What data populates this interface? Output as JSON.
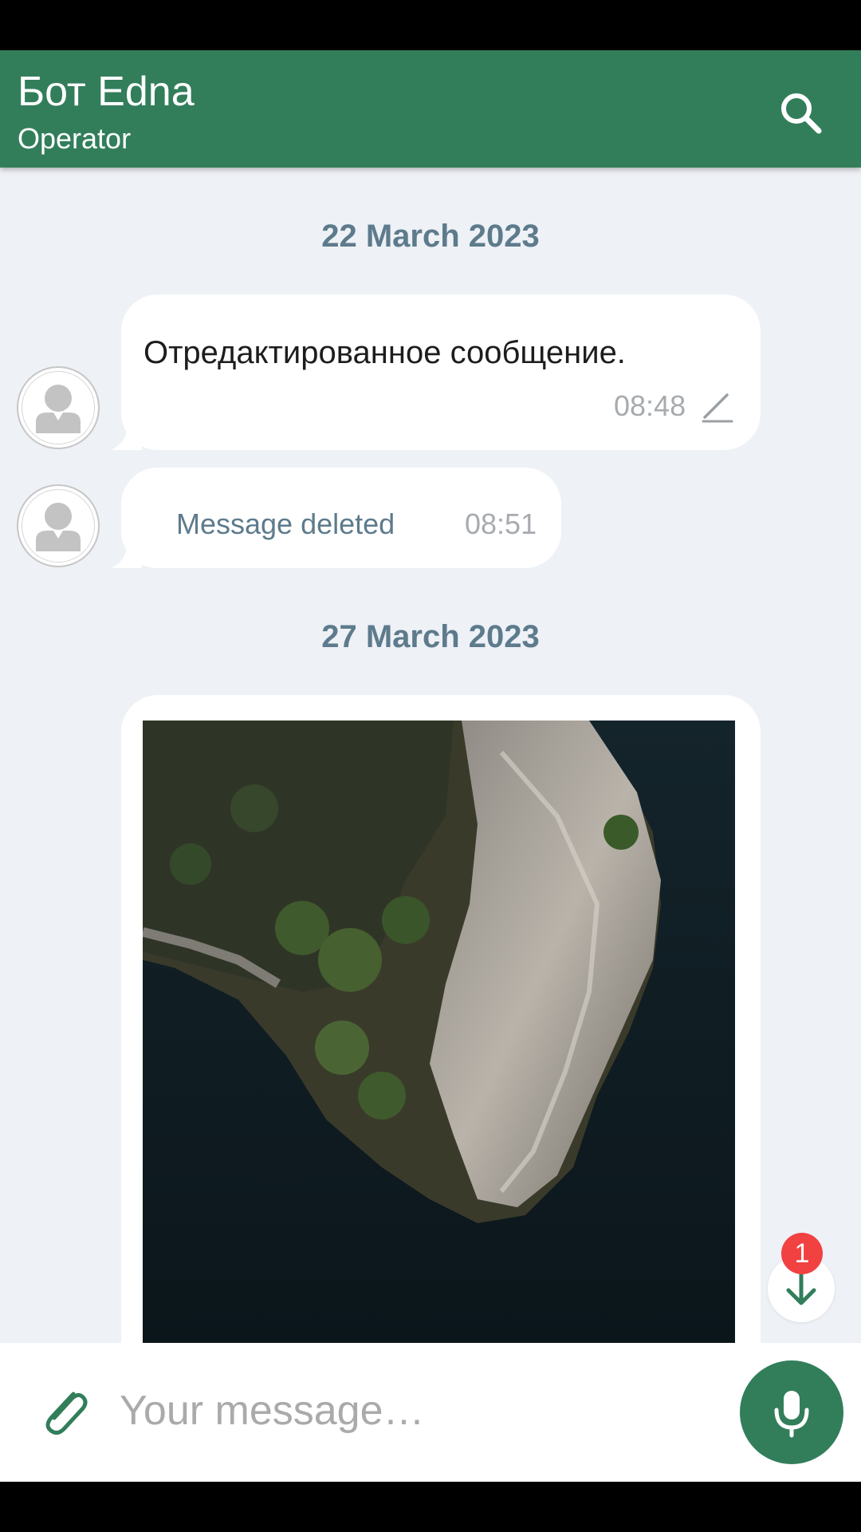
{
  "header": {
    "title": "Бот Edna",
    "subtitle": "Operator",
    "search_icon": "search-icon"
  },
  "colors": {
    "primary": "#327e5b",
    "background": "#eef1f6",
    "date_text": "#5d7b8c",
    "badge": "#f14141"
  },
  "messages": [
    {
      "date": "22 March 2023",
      "items": [
        {
          "type": "text",
          "text": "Отредактированное сообщение.",
          "time": "08:48",
          "edited": true,
          "edited_icon": "pencil-icon"
        },
        {
          "type": "deleted",
          "text": "Message deleted",
          "time": "08:51"
        }
      ]
    },
    {
      "date": "27 March 2023",
      "items": [
        {
          "type": "image",
          "description_icon": "photo"
        }
      ]
    }
  ],
  "composer": {
    "placeholder": "Your message…",
    "attach_icon": "paperclip-icon",
    "mic_icon": "microphone-icon"
  },
  "scroll_down": {
    "icon": "arrow-down-icon",
    "unread_count": "1"
  }
}
